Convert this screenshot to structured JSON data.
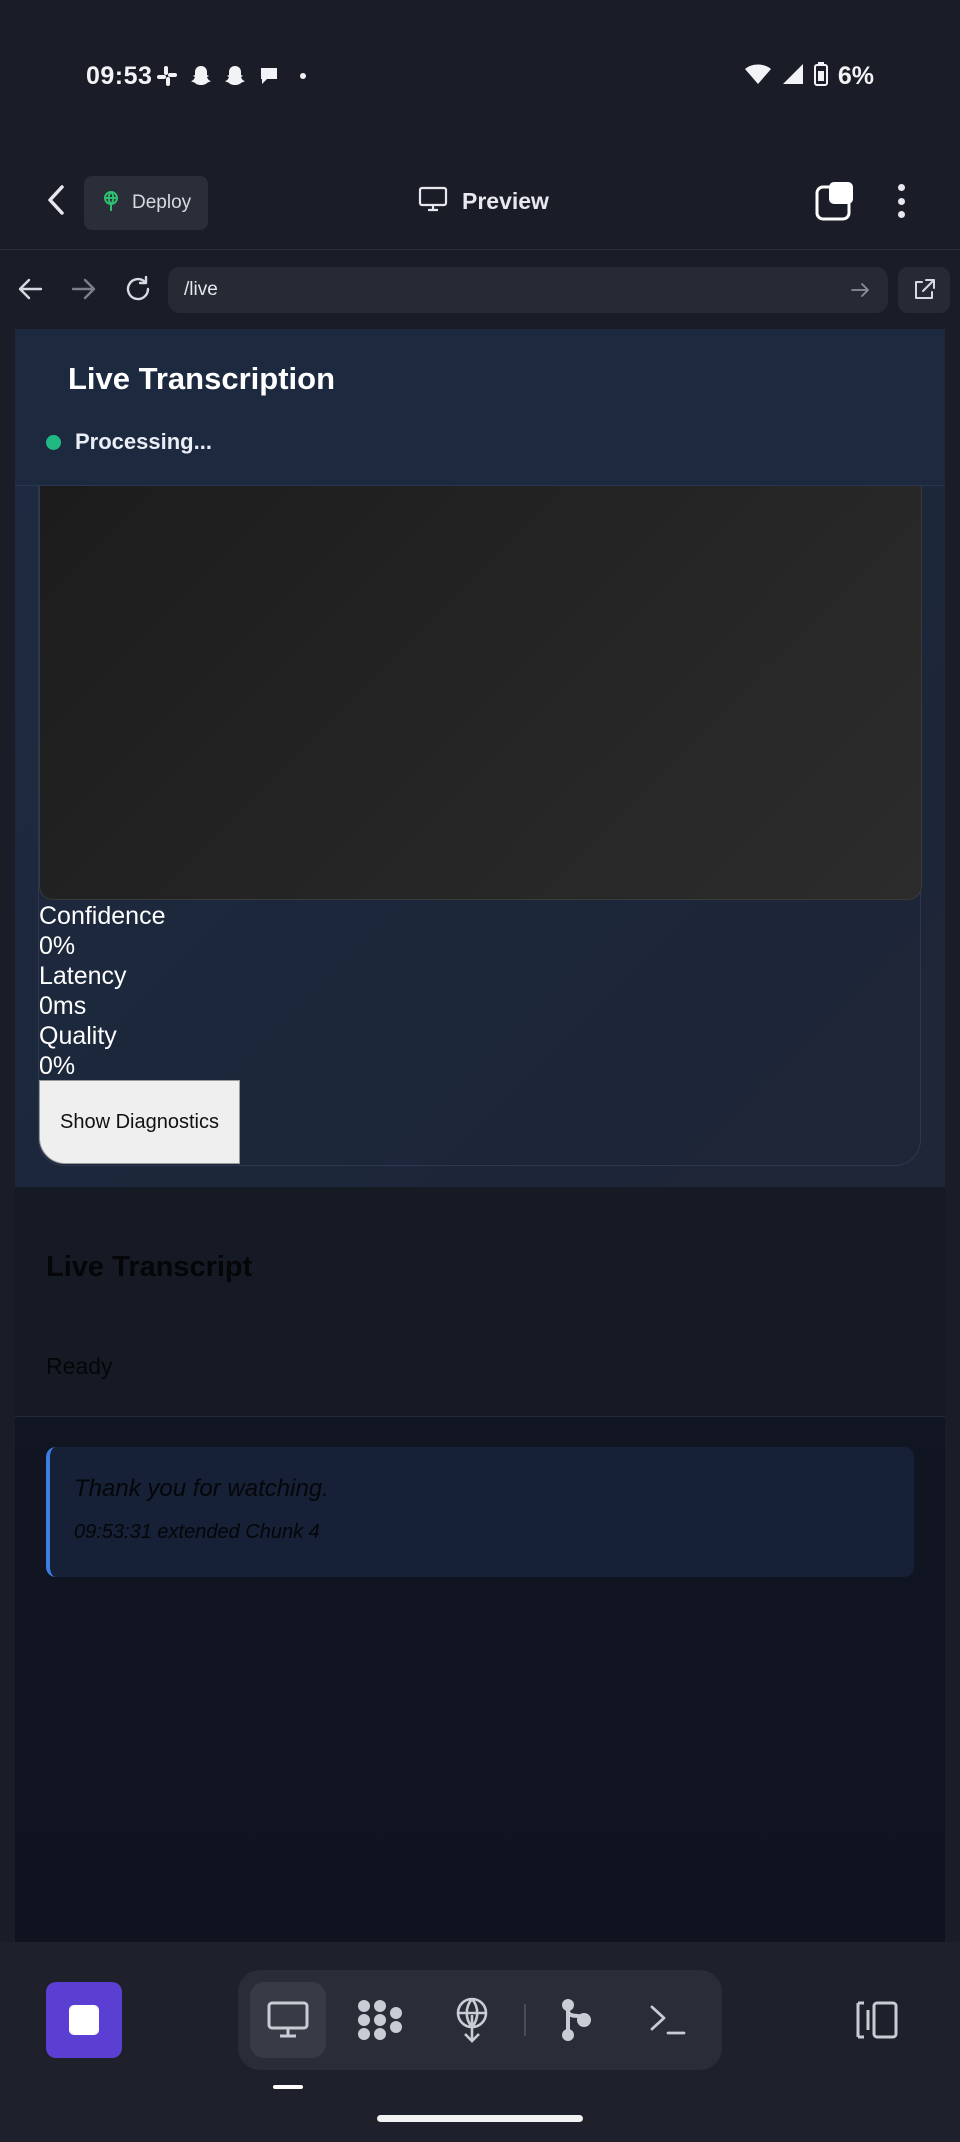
{
  "status_bar": {
    "time": "09:53",
    "notification_icons": [
      "slack-icon",
      "snapchat-icon",
      "snapchat-icon",
      "chat-bubble-icon",
      "dot-icon"
    ],
    "battery": "6%"
  },
  "app_bar": {
    "deploy_label": "Deploy",
    "preview_label": "Preview"
  },
  "browser": {
    "url": "/live"
  },
  "page": {
    "title": "Live Transcription",
    "status": "Processing...",
    "metrics": {
      "confidence_label": "Confidence",
      "confidence_value": "0%",
      "latency_label": "Latency",
      "latency_value": "0ms",
      "quality_label": "Quality",
      "quality_value": "0%"
    },
    "diagnostics_button": "Show Diagnostics",
    "transcript_title": "Live Transcript",
    "transcript_status": "Ready",
    "entries": [
      {
        "text": "Thank you for watching.",
        "meta": "09:53:31 extended Chunk 4"
      }
    ]
  },
  "colors": {
    "status_dot": "#1fb981",
    "accent_stop": "#5b3fd3",
    "entry_border": "#3d7fe0"
  }
}
